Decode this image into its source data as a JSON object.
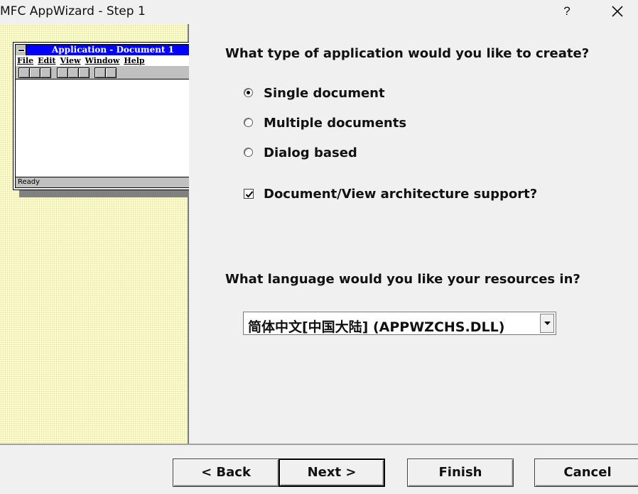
{
  "window": {
    "title": "MFC AppWizard - Step 1",
    "help_label": "?",
    "close_icon": "close-icon"
  },
  "preview": {
    "title": "Application - Document 1",
    "menu": [
      "File",
      "Edit",
      "View",
      "Window",
      "Help"
    ],
    "status": "Ready"
  },
  "main": {
    "question_app_type": "What type of application would you like to create?",
    "app_types": [
      {
        "label": "Single document",
        "selected": true
      },
      {
        "label": "Multiple documents",
        "selected": false
      },
      {
        "label": "Dialog based",
        "selected": false
      }
    ],
    "docview_label": "Document/View architecture support?",
    "docview_checked": true,
    "question_language": "What language would you like your resources in?",
    "language_selected": "简体中文[中国大陆] (APPWZCHS.DLL)"
  },
  "buttons": {
    "back": "< Back",
    "next": "Next >",
    "finish": "Finish",
    "cancel": "Cancel"
  },
  "colors": {
    "preview_title_bg": "#0000ff",
    "left_pane_bg": "#fefed0"
  }
}
